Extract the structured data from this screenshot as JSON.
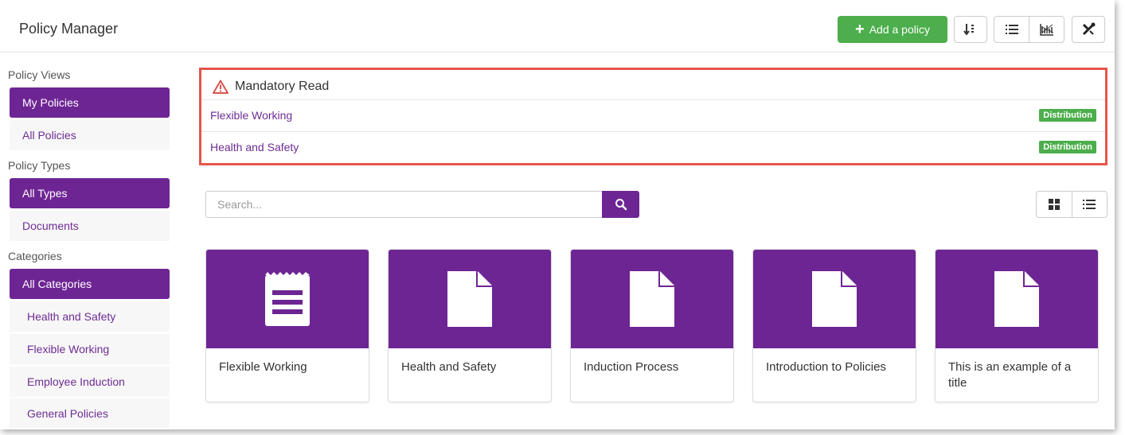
{
  "header": {
    "title": "Policy Manager",
    "add_button": "Add a policy",
    "tools": [
      "sort-icon",
      "list-icon",
      "chart-icon",
      "tools-icon"
    ]
  },
  "sidebar": {
    "views_label": "Policy Views",
    "views": [
      "My Policies",
      "All Policies"
    ],
    "types_label": "Policy Types",
    "types": [
      "All Types",
      "Documents"
    ],
    "categories_label": "Categories",
    "categories": [
      "All Categories",
      "Health and Safety",
      "Flexible Working",
      "Employee Induction",
      "General Policies"
    ]
  },
  "mandatory": {
    "title": "Mandatory Read",
    "items": [
      {
        "name": "Flexible Working",
        "badge": "Distribution"
      },
      {
        "name": "Health and Safety",
        "badge": "Distribution"
      }
    ]
  },
  "search": {
    "placeholder": "Search..."
  },
  "cards": [
    {
      "title": "Flexible Working",
      "icon": "notepad-icon"
    },
    {
      "title": "Health and Safety",
      "icon": "document-icon"
    },
    {
      "title": "Induction Process",
      "icon": "document-icon"
    },
    {
      "title": "Introduction to Policies",
      "icon": "document-icon"
    },
    {
      "title": "This is an example of a title",
      "icon": "document-icon"
    }
  ],
  "colors": {
    "accent": "#6e2594",
    "success": "#4cae4c",
    "highlight_border": "#e8544a",
    "link": "#6e2c92"
  }
}
